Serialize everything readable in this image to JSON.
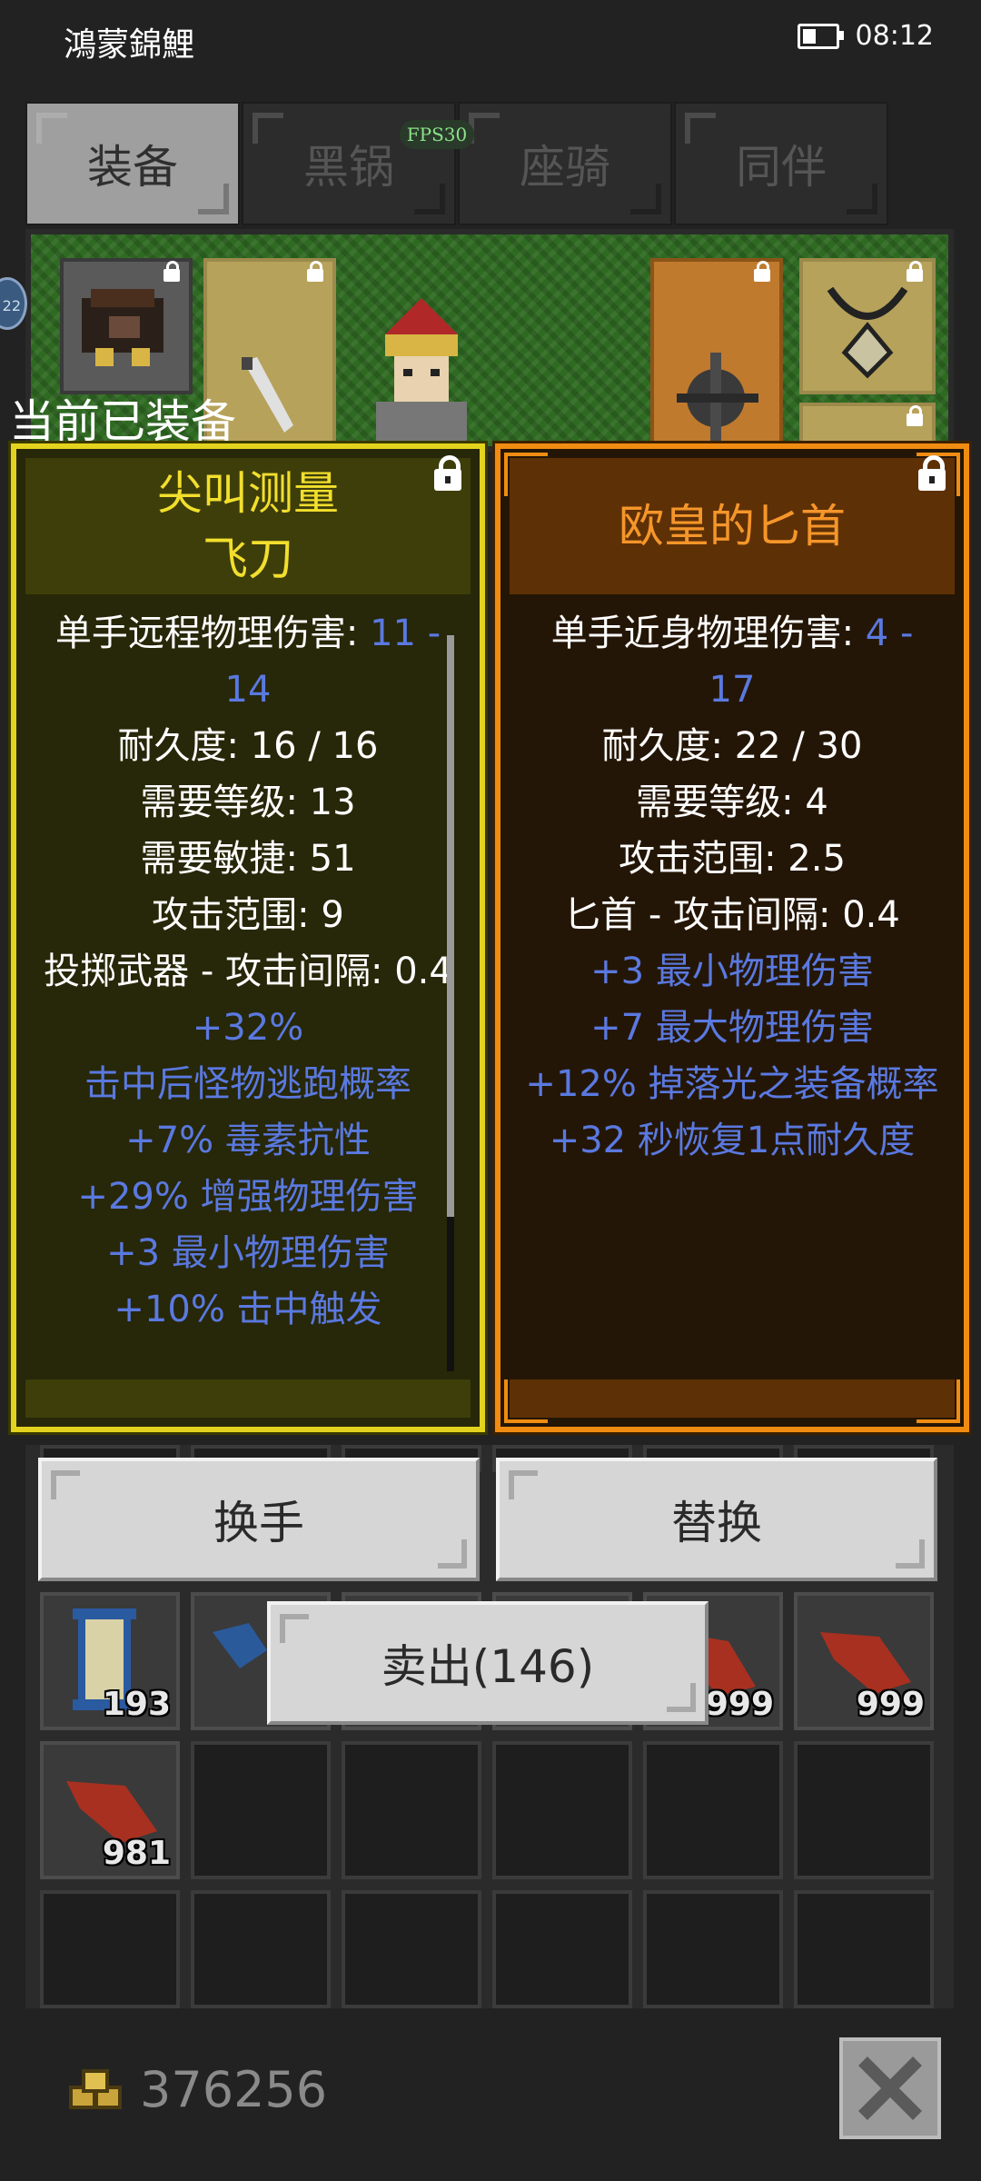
{
  "status": {
    "carrier": "鴻蒙錦鯉",
    "time": "08:12"
  },
  "tabs": [
    {
      "label": "装备",
      "active": true
    },
    {
      "label": "黑锅",
      "active": false
    },
    {
      "label": "座骑",
      "active": false
    },
    {
      "label": "同伴",
      "active": false
    }
  ],
  "fps": "FPS30",
  "side_badge": "22",
  "current_equipped_label": "当前已装备",
  "left_item": {
    "title_line1": "尖叫测量",
    "title_line2": "飞刀",
    "lines": [
      {
        "text": "单手远程物理伤害: ",
        "value": "11 -",
        "color": "white"
      },
      {
        "text": "14",
        "color": "blue"
      },
      {
        "text": "耐久度: 16 / 16",
        "color": "white"
      },
      {
        "text": "需要等级: 13",
        "color": "white"
      },
      {
        "text": "需要敏捷: 51",
        "color": "white"
      },
      {
        "text": "攻击范围: 9",
        "color": "white"
      },
      {
        "text": "投掷武器 - 攻击间隔: 0.4",
        "color": "white"
      },
      {
        "text": "+32%",
        "color": "blue"
      },
      {
        "text": "击中后怪物逃跑概率",
        "color": "blue"
      },
      {
        "text": "+7% 毒素抗性",
        "color": "blue"
      },
      {
        "text": "+29% 增强物理伤害",
        "color": "blue"
      },
      {
        "text": "+3 最小物理伤害",
        "color": "blue"
      },
      {
        "text": "+10% 击中触发",
        "color": "blue"
      }
    ]
  },
  "right_item": {
    "title": "欧皇的匕首",
    "lines": [
      {
        "text": "单手近身物理伤害: ",
        "value": "4 -",
        "color": "white"
      },
      {
        "text": "17",
        "color": "blue"
      },
      {
        "text": "耐久度: 22 / 30",
        "color": "white"
      },
      {
        "text": "需要等级: 4",
        "color": "white"
      },
      {
        "text": "攻击范围: 2.5",
        "color": "white"
      },
      {
        "text": "匕首 - 攻击间隔: 0.4",
        "color": "white"
      },
      {
        "text": "+3 最小物理伤害",
        "color": "blue"
      },
      {
        "text": "+7 最大物理伤害",
        "color": "blue"
      },
      {
        "text": "+12% 掉落光之装备概率",
        "color": "blue"
      },
      {
        "text": "+32 秒恢复1点耐久度",
        "color": "blue"
      }
    ]
  },
  "buttons": {
    "swap_hand": "换手",
    "replace": "替换",
    "sell": "卖出(146)"
  },
  "inventory": {
    "counts": [
      "193",
      "999",
      "999",
      "981"
    ]
  },
  "gold": "376256",
  "colors": {
    "rare_yellow": "#e3d31e",
    "unique_orange": "#f08c12",
    "magic_blue": "#5a79e0"
  }
}
